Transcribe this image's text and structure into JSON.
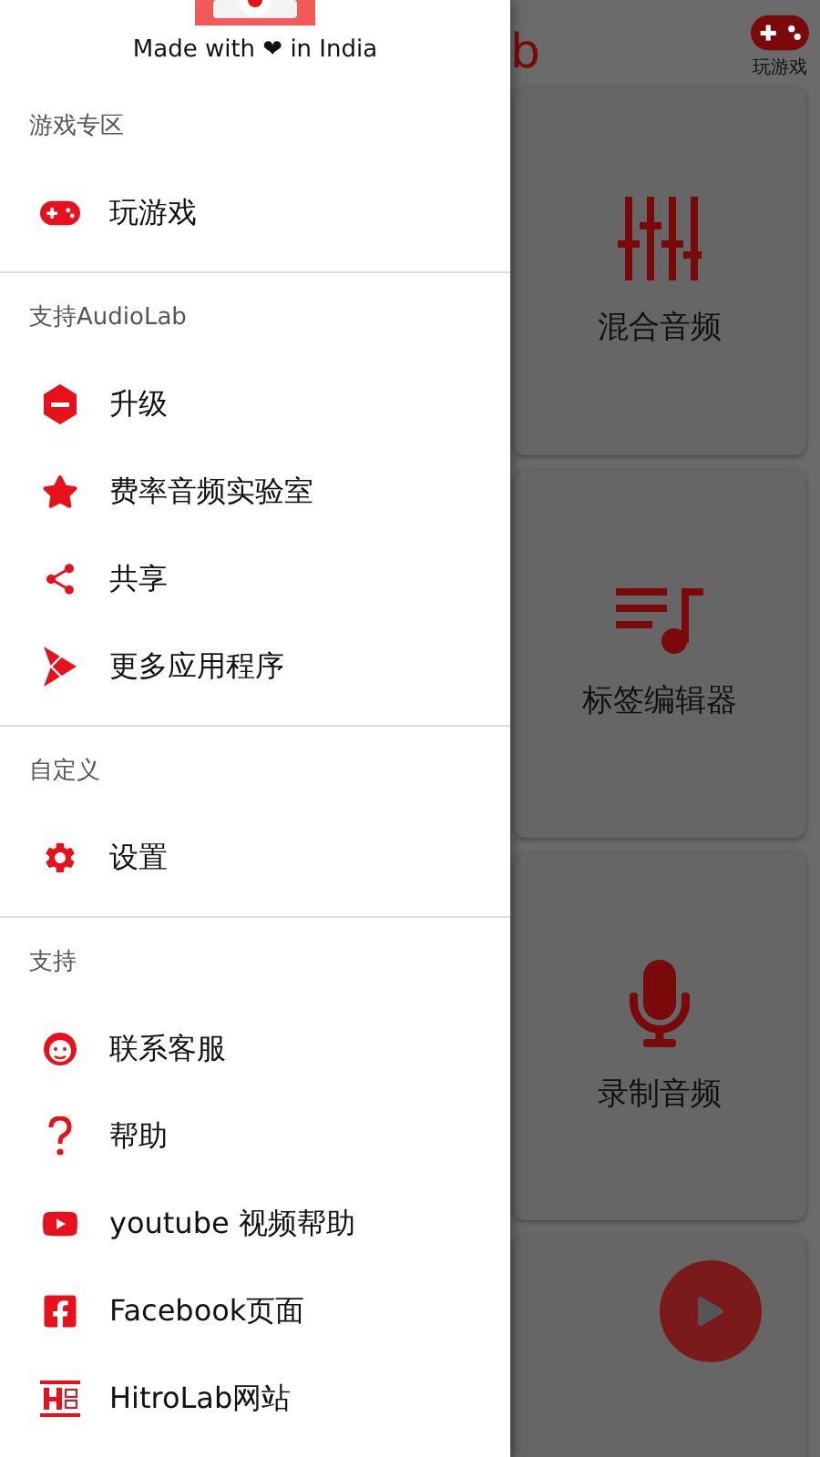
{
  "drawer": {
    "tagline": "Made with ❤ in India",
    "sections": [
      {
        "header": "游戏专区",
        "items": [
          {
            "label": "玩游戏"
          }
        ]
      },
      {
        "header": "支持AudioLab",
        "items": [
          {
            "label": "升级"
          },
          {
            "label": "费率音频实验室"
          },
          {
            "label": "共享"
          },
          {
            "label": "更多应用程序"
          }
        ]
      },
      {
        "header": "自定义",
        "items": [
          {
            "label": "设置"
          }
        ]
      },
      {
        "header": "支持",
        "items": [
          {
            "label": "联系客服"
          },
          {
            "label": "帮助"
          },
          {
            "label": "youtube 视频帮助"
          },
          {
            "label": "Facebook页面"
          },
          {
            "label": "HitroLab网站"
          }
        ]
      }
    ]
  },
  "app": {
    "title": "b",
    "games_button": "玩游戏",
    "cards": [
      {
        "label": "混合音频"
      },
      {
        "label": "标签编辑器"
      },
      {
        "label": "录制音频"
      }
    ]
  }
}
